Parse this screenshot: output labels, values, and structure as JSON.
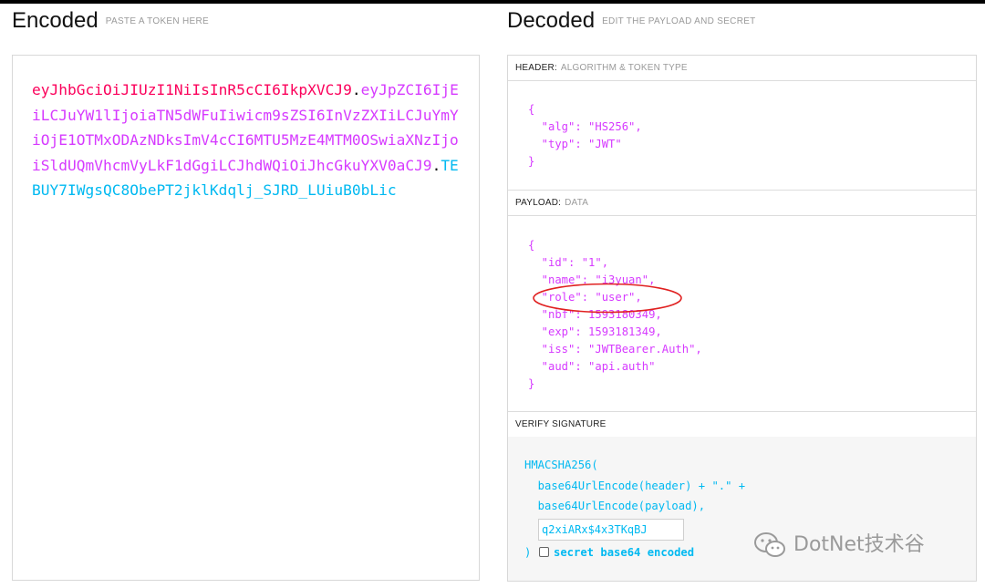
{
  "encoded": {
    "title": "Encoded",
    "subtitle": "PASTE A TOKEN HERE",
    "token_header": "eyJhbGciOiJIUzI1NiIsInR5cCI6IkpXVCJ9",
    "token_payload": "eyJpZCI6IjEiLCJuYW1lIjoiaTN5dWFuIiwicm9sZSI6InVzZXIiLCJuYmYiOjE1OTMxODAzNDksImV4cCI6MTU5MzE4MTM0OSwiaXNzIjoiSldUQmVhcmVyLkF1dGgiLCJhdWQiOiJhcGkuYXV0aCJ9",
    "token_signature": "TEBUY7IWgsQC8ObePT2jklKdqlj_SJRD_LUiuB0bLic",
    "dot": "."
  },
  "decoded": {
    "title": "Decoded",
    "subtitle": "EDIT THE PAYLOAD AND SECRET",
    "header_section": {
      "label": "HEADER:",
      "sublabel": "ALGORITHM & TOKEN TYPE"
    },
    "header_json": "{\n  \"alg\": \"HS256\",\n  \"typ\": \"JWT\"\n}",
    "payload_section": {
      "label": "PAYLOAD:",
      "sublabel": "DATA"
    },
    "payload_json": "{\n  \"id\": \"1\",\n  \"name\": \"i3yuan\",\n  \"role\": \"user\",\n  \"nbf\": 1593180349,\n  \"exp\": 1593181349,\n  \"iss\": \"JWTBearer.Auth\",\n  \"aud\": \"api.auth\"\n}",
    "verify_section": {
      "label": "VERIFY SIGNATURE"
    },
    "signature_code": "HMACSHA256(\n  base64UrlEncode(header) + \".\" +\n  base64UrlEncode(payload),",
    "secret_value": "q2xiARx$4x3TKqBJ",
    "close_paren": ")",
    "secret_b64_label": "secret base64 encoded",
    "secret_b64_checked": false
  },
  "watermark": {
    "text": "DotNet技术谷",
    "icon": "wechat-icon"
  },
  "colors": {
    "header": "#fb015b",
    "payload": "#d63aff",
    "signature": "#00b9f1",
    "annotation": "#e02020"
  }
}
